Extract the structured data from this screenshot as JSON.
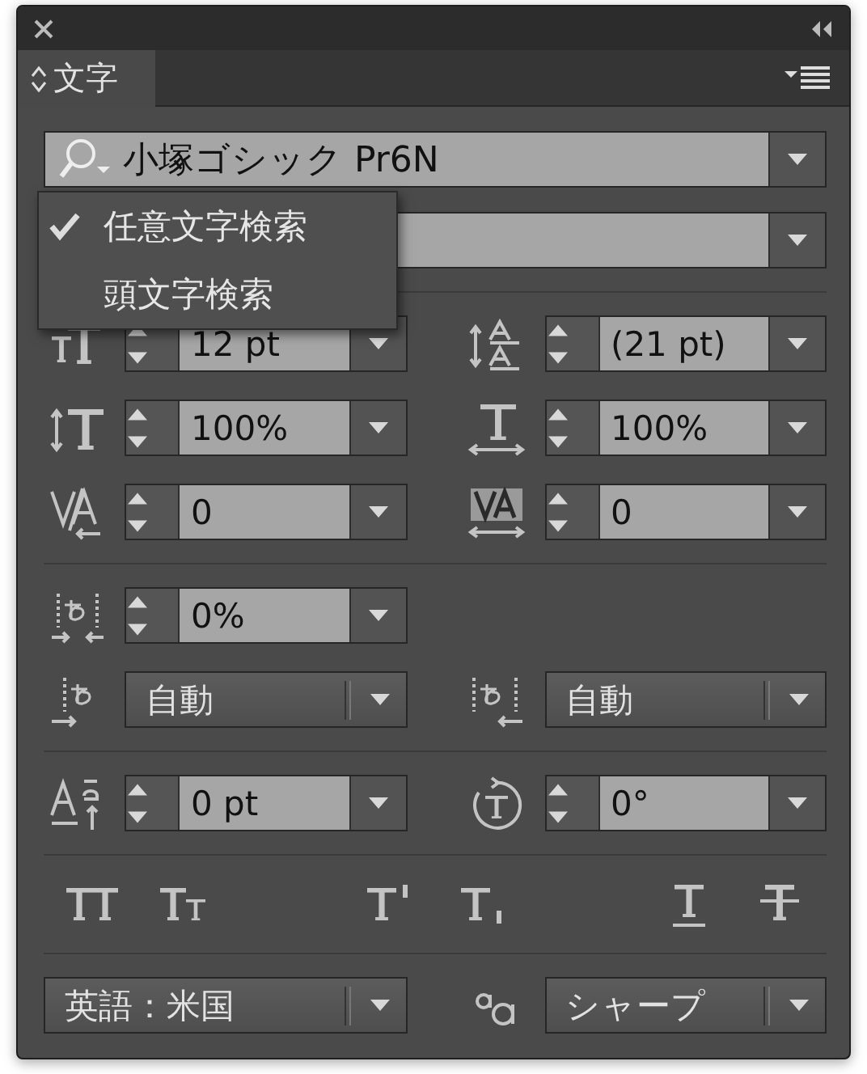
{
  "panel_tab": {
    "label": "文字",
    "selected": true
  },
  "font_family": {
    "value": "小塚ゴシック Pr6N"
  },
  "search_menu": {
    "items": [
      {
        "label": "任意文字検索",
        "checked": true
      },
      {
        "label": "頭文字検索",
        "checked": false
      }
    ]
  },
  "sections": [
    {
      "rows": [
        {
          "cells": [
            {
              "kind": "spin",
              "value": "12 pt"
            },
            {
              "kind": "spin",
              "value": "(21 pt)"
            }
          ]
        },
        {
          "cells": [
            {
              "kind": "spin",
              "value": "100%"
            },
            {
              "kind": "spin",
              "value": "100%"
            }
          ]
        },
        {
          "cells": [
            {
              "kind": "spin",
              "value": "0"
            },
            {
              "kind": "spin",
              "value": "0"
            }
          ]
        }
      ]
    },
    {
      "rows": [
        {
          "cells": [
            {
              "kind": "spin",
              "value": "0%"
            }
          ]
        },
        {
          "cells": [
            {
              "kind": "dropdown",
              "value": "自動"
            },
            {
              "kind": "dropdown",
              "value": "自動"
            }
          ]
        }
      ]
    },
    {
      "rows": [
        {
          "cells": [
            {
              "kind": "spin",
              "value": "0 pt"
            },
            {
              "kind": "spin",
              "value": "0°"
            }
          ]
        }
      ]
    }
  ],
  "language": {
    "kind": "dropdown",
    "value": "英語：米国"
  },
  "antialias": {
    "kind": "dropdown",
    "value": "シャープ"
  }
}
